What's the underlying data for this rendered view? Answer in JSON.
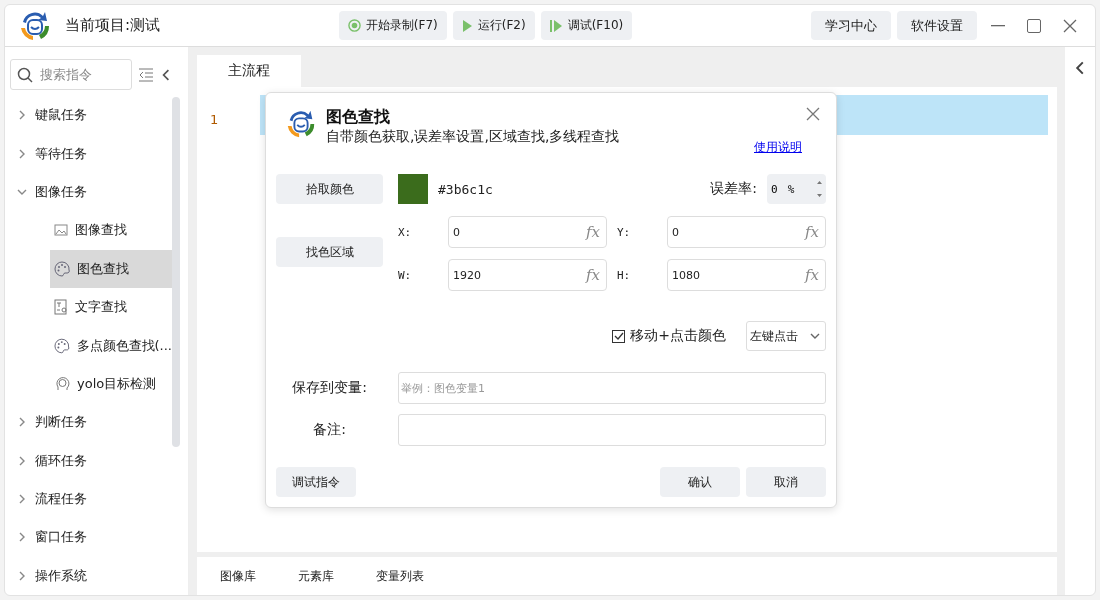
{
  "app": {
    "project_title": "当前项目:测试"
  },
  "toolbar": [
    {
      "kind": "record",
      "label": "开始录制(F7)"
    },
    {
      "kind": "run",
      "label": "运行(F2)"
    },
    {
      "kind": "debug",
      "label": "调试(F10)"
    }
  ],
  "header_buttons": [
    "学习中心",
    "软件设置"
  ],
  "sidebar": {
    "search_placeholder": "搜索指令",
    "items": [
      {
        "label": "键鼠任务",
        "expanded": false
      },
      {
        "label": "等待任务",
        "expanded": false
      },
      {
        "label": "图像任务",
        "expanded": true,
        "children": [
          {
            "label": "图像查找",
            "kind": "image",
            "selected": false
          },
          {
            "label": "图色查找",
            "kind": "palette",
            "selected": true
          },
          {
            "label": "文字查找",
            "kind": "text",
            "selected": false
          },
          {
            "label": "多点颜色查找(...",
            "kind": "palette",
            "selected": false
          },
          {
            "label": "yolo目标检测",
            "kind": "ai",
            "selected": false
          }
        ]
      },
      {
        "label": "判断任务",
        "expanded": false
      },
      {
        "label": "循环任务",
        "expanded": false
      },
      {
        "label": "流程任务",
        "expanded": false
      },
      {
        "label": "窗口任务",
        "expanded": false
      },
      {
        "label": "操作系统",
        "expanded": false
      }
    ]
  },
  "editor": {
    "tabs": [
      {
        "label": "主流程",
        "selected": true
      }
    ],
    "line_numbers": [
      "1"
    ]
  },
  "dialog": {
    "title": "图色查找",
    "subtitle": "自带颜色获取,误差率设置,区域查找,多线程查找",
    "help_link": "使用说明",
    "pick_button": "拾取颜色",
    "picked_color": "#3b6c1c",
    "tolerance": {
      "label": "误差率:",
      "value": "0",
      "unit": "%"
    },
    "region_button": "找色区域",
    "fields": [
      {
        "label": "X:",
        "value": "0",
        "fx": "fx"
      },
      {
        "label": "Y:",
        "value": "0",
        "fx": "fx"
      },
      {
        "label": "W:",
        "value": "1920",
        "fx": "fx"
      },
      {
        "label": "H:",
        "value": "1080",
        "fx": "fx"
      }
    ],
    "move_click": {
      "label": "移动+点击颜色",
      "checked": true
    },
    "click_mode": "左键点击",
    "save_var": {
      "label": "保存到变量:",
      "placeholder": "举例：图色变量1"
    },
    "note": {
      "label": "备注:"
    },
    "debug_button": "调试指令",
    "confirm_button": "确认",
    "cancel_button": "取消"
  },
  "bottom_tabs": [
    "图像库",
    "元素库",
    "变量列表"
  ]
}
